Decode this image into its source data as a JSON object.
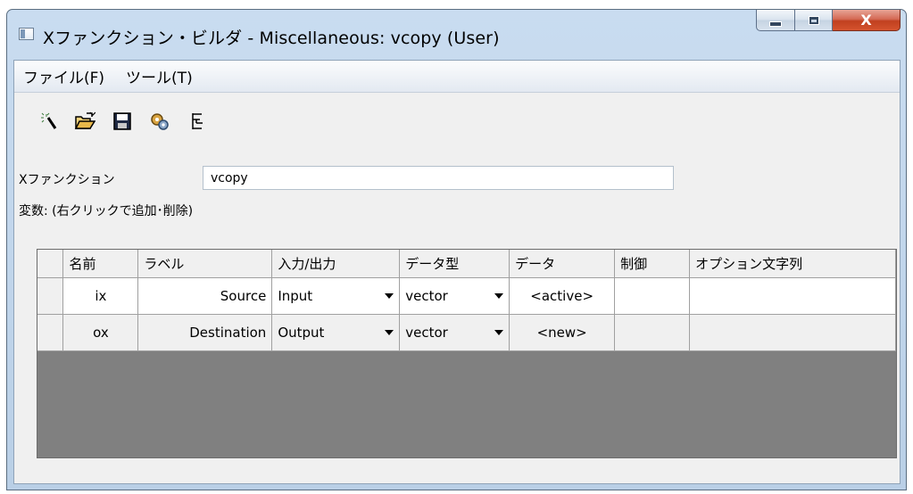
{
  "window": {
    "title": "Xファンクション・ビルダ - Miscellaneous: vcopy (User)",
    "close_label": "X"
  },
  "menu": {
    "items": [
      {
        "label": "ファイル(F)"
      },
      {
        "label": "ツール(T)"
      }
    ]
  },
  "toolbar": {
    "buttons": [
      {
        "icon": "magic-wand-icon"
      },
      {
        "icon": "open-folder-icon"
      },
      {
        "icon": "save-disk-icon"
      },
      {
        "icon": "compile-gears-icon"
      },
      {
        "icon": "tree-view-icon"
      }
    ]
  },
  "xfunction": {
    "label": "Xファンクション",
    "value": "vcopy"
  },
  "variables_label": "変数: (右クリックで追加･削除)",
  "table": {
    "columns": [
      "名前",
      "ラベル",
      "入力/出力",
      "データ型",
      "データ",
      "制御",
      "オプション文字列"
    ],
    "rows": [
      {
        "name": "ix",
        "label": "Source",
        "io": "Input",
        "type": "vector",
        "data": "<active>",
        "control": "",
        "option": ""
      },
      {
        "name": "ox",
        "label": "Destination",
        "io": "Output",
        "type": "vector",
        "data": "<new>",
        "control": "",
        "option": ""
      }
    ]
  },
  "colors": {
    "grid_empty_area": "#808080",
    "close_button": "#c1401f",
    "window_frame": "#b9cfe6"
  }
}
